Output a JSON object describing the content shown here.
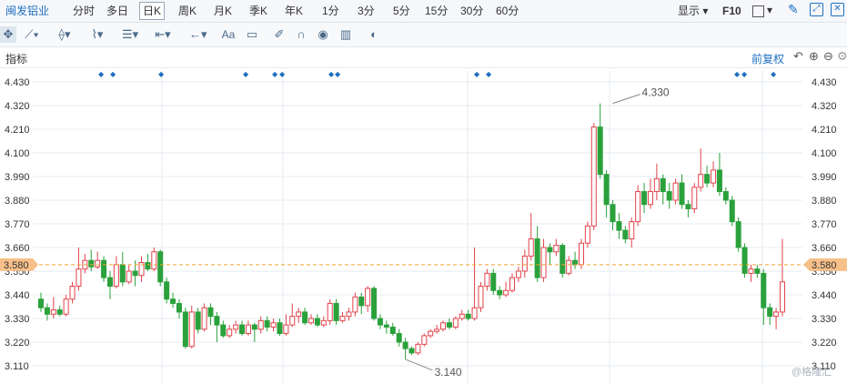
{
  "topbar": {
    "title": "闽发铝业",
    "periods": [
      "分时",
      "多日",
      "日K",
      "周K",
      "月K",
      "季K",
      "年K",
      "1分",
      "3分",
      "5分",
      "15分",
      "30分",
      "60分"
    ],
    "active_period": "日K",
    "display_label": "显示",
    "f10_label": "F10"
  },
  "toolbar": {
    "icons": [
      "move-icon",
      "line-tool-icon",
      "channel-tool-icon",
      "wave-tool-icon",
      "fibonacci-tool-icon",
      "range-tool-icon",
      "arrow-tool-icon",
      "text-tool-icon",
      "comment-tool-icon",
      "pen-icon",
      "magnet-icon",
      "eye-icon",
      "trash-icon",
      "toggle-icon"
    ],
    "text_tool_label": "Aa"
  },
  "indicator_bar": {
    "label": "指标",
    "adjust_label": "前复权"
  },
  "colors": {
    "up": "#e2434b",
    "down": "#2aa13b",
    "grid": "#e6ebf0",
    "price_line": "#f0a030",
    "price_tag": "#f7c08a"
  },
  "chart_data": {
    "type": "candlestick",
    "yticks": [
      "4.430",
      "4.320",
      "4.210",
      "4.100",
      "3.990",
      "3.880",
      "3.770",
      "3.660",
      "3.550",
      "3.440",
      "3.330",
      "3.220",
      "3.110"
    ],
    "ylim": [
      3.11,
      4.43
    ],
    "current_price": "3.580",
    "high_annotation": "4.330",
    "low_annotation": "3.140",
    "watermark": "@格隆汇",
    "candles": [
      [
        3.42,
        3.38,
        3.45,
        3.36
      ],
      [
        3.38,
        3.35,
        3.4,
        3.32
      ],
      [
        3.35,
        3.37,
        3.43,
        3.33
      ],
      [
        3.37,
        3.35,
        3.39,
        3.34
      ],
      [
        3.35,
        3.42,
        3.44,
        3.34
      ],
      [
        3.42,
        3.48,
        3.5,
        3.4
      ],
      [
        3.48,
        3.56,
        3.66,
        3.46
      ],
      [
        3.56,
        3.6,
        3.63,
        3.54
      ],
      [
        3.6,
        3.57,
        3.65,
        3.55
      ],
      [
        3.57,
        3.6,
        3.64,
        3.56
      ],
      [
        3.6,
        3.52,
        3.62,
        3.5
      ],
      [
        3.52,
        3.48,
        3.55,
        3.42
      ],
      [
        3.48,
        3.58,
        3.62,
        3.47
      ],
      [
        3.58,
        3.5,
        3.64,
        3.48
      ],
      [
        3.5,
        3.55,
        3.58,
        3.49
      ],
      [
        3.55,
        3.53,
        3.6,
        3.48
      ],
      [
        3.53,
        3.59,
        3.62,
        3.5
      ],
      [
        3.59,
        3.56,
        3.63,
        3.55
      ],
      [
        3.56,
        3.64,
        3.66,
        3.55
      ],
      [
        3.64,
        3.5,
        3.65,
        3.48
      ],
      [
        3.5,
        3.42,
        3.52,
        3.4
      ],
      [
        3.42,
        3.4,
        3.45,
        3.38
      ],
      [
        3.4,
        3.36,
        3.42,
        3.33
      ],
      [
        3.36,
        3.2,
        3.38,
        3.19
      ],
      [
        3.2,
        3.36,
        3.39,
        3.19
      ],
      [
        3.36,
        3.28,
        3.38,
        3.26
      ],
      [
        3.28,
        3.38,
        3.4,
        3.27
      ],
      [
        3.38,
        3.34,
        3.4,
        3.3
      ],
      [
        3.34,
        3.3,
        3.36,
        3.22
      ],
      [
        3.3,
        3.25,
        3.32,
        3.24
      ],
      [
        3.25,
        3.28,
        3.3,
        3.24
      ],
      [
        3.28,
        3.3,
        3.32,
        3.26
      ],
      [
        3.3,
        3.26,
        3.32,
        3.25
      ],
      [
        3.26,
        3.3,
        3.32,
        3.25
      ],
      [
        3.3,
        3.28,
        3.31,
        3.22
      ],
      [
        3.28,
        3.32,
        3.34,
        3.26
      ],
      [
        3.32,
        3.29,
        3.34,
        3.27
      ],
      [
        3.29,
        3.31,
        3.33,
        3.27
      ],
      [
        3.31,
        3.26,
        3.33,
        3.25
      ],
      [
        3.26,
        3.3,
        3.35,
        3.25
      ],
      [
        3.3,
        3.34,
        3.4,
        3.29
      ],
      [
        3.34,
        3.36,
        3.38,
        3.31
      ],
      [
        3.36,
        3.31,
        3.38,
        3.3
      ],
      [
        3.31,
        3.33,
        3.35,
        3.3
      ],
      [
        3.33,
        3.3,
        3.35,
        3.29
      ],
      [
        3.3,
        3.32,
        3.34,
        3.29
      ],
      [
        3.32,
        3.4,
        3.42,
        3.3
      ],
      [
        3.4,
        3.32,
        3.42,
        3.3
      ],
      [
        3.32,
        3.34,
        3.36,
        3.31
      ],
      [
        3.34,
        3.36,
        3.38,
        3.32
      ],
      [
        3.36,
        3.43,
        3.45,
        3.34
      ],
      [
        3.43,
        3.39,
        3.45,
        3.35
      ],
      [
        3.39,
        3.47,
        3.48,
        3.36
      ],
      [
        3.47,
        3.33,
        3.48,
        3.32
      ],
      [
        3.33,
        3.3,
        3.35,
        3.28
      ],
      [
        3.3,
        3.29,
        3.32,
        3.26
      ],
      [
        3.29,
        3.26,
        3.31,
        3.25
      ],
      [
        3.26,
        3.22,
        3.28,
        3.2
      ],
      [
        3.22,
        3.19,
        3.24,
        3.14
      ],
      [
        3.19,
        3.17,
        3.2,
        3.16
      ],
      [
        3.17,
        3.21,
        3.22,
        3.16
      ],
      [
        3.21,
        3.25,
        3.26,
        3.2
      ],
      [
        3.25,
        3.27,
        3.28,
        3.24
      ],
      [
        3.27,
        3.28,
        3.3,
        3.26
      ],
      [
        3.28,
        3.31,
        3.32,
        3.27
      ],
      [
        3.31,
        3.29,
        3.33,
        3.28
      ],
      [
        3.29,
        3.33,
        3.34,
        3.28
      ],
      [
        3.33,
        3.35,
        3.37,
        3.32
      ],
      [
        3.35,
        3.33,
        3.37,
        3.32
      ],
      [
        3.33,
        3.38,
        3.66,
        3.32
      ],
      [
        3.38,
        3.48,
        3.5,
        3.36
      ],
      [
        3.48,
        3.54,
        3.56,
        3.46
      ],
      [
        3.54,
        3.46,
        3.56,
        3.44
      ],
      [
        3.46,
        3.44,
        3.48,
        3.42
      ],
      [
        3.44,
        3.46,
        3.5,
        3.43
      ],
      [
        3.46,
        3.52,
        3.54,
        3.45
      ],
      [
        3.52,
        3.55,
        3.57,
        3.5
      ],
      [
        3.55,
        3.62,
        3.65,
        3.52
      ],
      [
        3.62,
        3.7,
        3.82,
        3.6
      ],
      [
        3.7,
        3.52,
        3.76,
        3.5
      ],
      [
        3.52,
        3.66,
        3.7,
        3.5
      ],
      [
        3.66,
        3.64,
        3.68,
        3.58
      ],
      [
        3.64,
        3.67,
        3.7,
        3.62
      ],
      [
        3.67,
        3.54,
        3.68,
        3.52
      ],
      [
        3.54,
        3.6,
        3.62,
        3.53
      ],
      [
        3.6,
        3.58,
        3.64,
        3.56
      ],
      [
        3.58,
        3.68,
        3.7,
        3.56
      ],
      [
        3.68,
        3.76,
        3.78,
        3.66
      ],
      [
        3.76,
        4.22,
        4.24,
        3.74
      ],
      [
        4.22,
        4.0,
        4.33,
        3.98
      ],
      [
        4.0,
        3.86,
        4.02,
        3.8
      ],
      [
        3.86,
        3.78,
        3.88,
        3.74
      ],
      [
        3.78,
        3.74,
        3.82,
        3.7
      ],
      [
        3.74,
        3.7,
        3.76,
        3.68
      ],
      [
        3.7,
        3.78,
        3.8,
        3.66
      ],
      [
        3.78,
        3.92,
        3.95,
        3.76
      ],
      [
        3.92,
        3.86,
        3.96,
        3.82
      ],
      [
        3.86,
        3.92,
        3.98,
        3.84
      ],
      [
        3.92,
        3.98,
        4.05,
        3.88
      ],
      [
        3.98,
        3.92,
        4.0,
        3.86
      ],
      [
        3.92,
        3.88,
        3.96,
        3.84
      ],
      [
        3.88,
        3.96,
        3.98,
        3.86
      ],
      [
        3.96,
        3.86,
        4.0,
        3.84
      ],
      [
        3.86,
        3.84,
        3.88,
        3.8
      ],
      [
        3.84,
        3.94,
        3.96,
        3.82
      ],
      [
        3.94,
        4.0,
        4.12,
        3.92
      ],
      [
        4.0,
        3.96,
        4.04,
        3.94
      ],
      [
        3.96,
        4.02,
        4.06,
        3.94
      ],
      [
        4.02,
        3.92,
        4.1,
        3.9
      ],
      [
        3.92,
        3.88,
        3.94,
        3.86
      ],
      [
        3.88,
        3.78,
        3.9,
        3.76
      ],
      [
        3.78,
        3.66,
        3.8,
        3.64
      ],
      [
        3.66,
        3.54,
        3.68,
        3.52
      ],
      [
        3.54,
        3.56,
        3.58,
        3.5
      ],
      [
        3.56,
        3.54,
        3.58,
        3.52
      ],
      [
        3.54,
        3.38,
        3.56,
        3.3
      ],
      [
        3.38,
        3.34,
        3.4,
        3.3
      ],
      [
        3.34,
        3.36,
        3.38,
        3.28
      ],
      [
        3.36,
        3.5,
        3.7,
        3.34
      ]
    ]
  }
}
